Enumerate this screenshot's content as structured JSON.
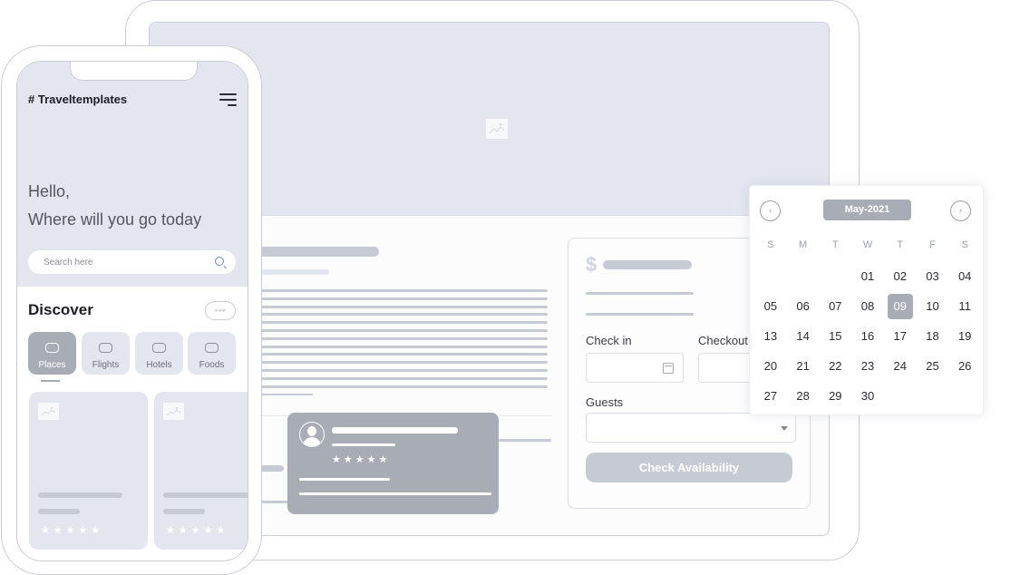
{
  "mobile": {
    "brand": "# Traveltemplates",
    "greeting_line1": "Hello,",
    "greeting_line2": "Where will you go today",
    "search_placeholder": "Search here",
    "section_title": "Discover",
    "more_label": "◦◦◦",
    "categories": [
      {
        "label": "Places",
        "active": true
      },
      {
        "label": "Flights",
        "active": false
      },
      {
        "label": "Hotels",
        "active": false
      },
      {
        "label": "Foods",
        "active": false
      }
    ],
    "cards": [
      {
        "stars": "★★★★★"
      },
      {
        "stars": "★★★★★"
      }
    ]
  },
  "booking": {
    "currency_symbol": "$",
    "checkin_label": "Check in",
    "checkout_label": "Checkout",
    "guests_label": "Guests",
    "button_label": "Check Availability"
  },
  "review": {
    "stars": "★★★★★"
  },
  "calendar": {
    "month": "May-2021",
    "prev_icon": "‹",
    "next_icon": "›",
    "weekdays": [
      "S",
      "M",
      "T",
      "W",
      "T",
      "F",
      "S"
    ],
    "selected": "09",
    "weeks": [
      [
        "",
        "",
        "",
        "01",
        "02",
        "03",
        "04"
      ],
      [
        "05",
        "06",
        "07",
        "08",
        "09",
        "10",
        "11"
      ],
      [
        "13",
        "14",
        "15",
        "16",
        "17",
        "18",
        "19"
      ],
      [
        "20",
        "21",
        "22",
        "23",
        "24",
        "25",
        "26"
      ],
      [
        "27",
        "28",
        "29",
        "30",
        "",
        "",
        ""
      ]
    ]
  },
  "colors": {
    "placeholder_bg": "#e3e6ef",
    "accent_gray": "#a8acb5",
    "skeleton": "#c6cad3"
  }
}
